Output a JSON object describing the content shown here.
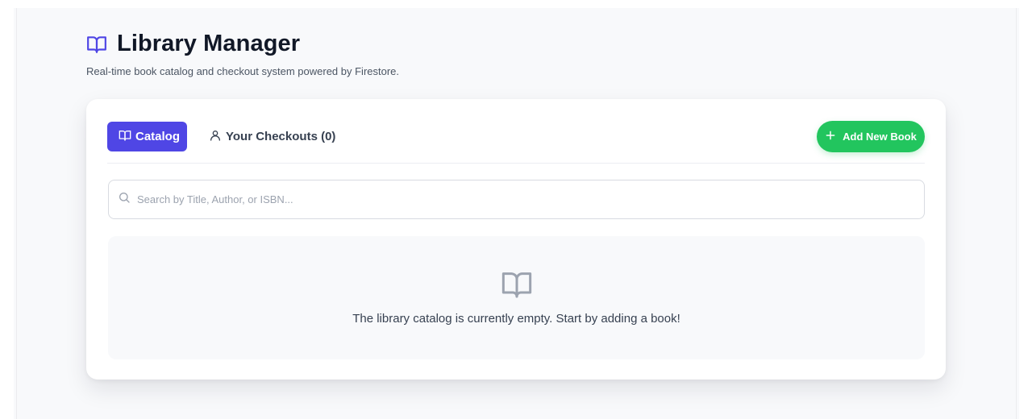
{
  "header": {
    "title": "Library Manager",
    "subtitle": "Real-time book catalog and checkout system powered by Firestore.",
    "icon": "book-open-icon"
  },
  "tabs": {
    "catalog_label": "Catalog",
    "checkouts_label": "Your Checkouts (0)",
    "active": "Catalog"
  },
  "actions": {
    "add_book_label": "Add New Book"
  },
  "search": {
    "value": "",
    "placeholder": "Search by Title, Author, or ISBN..."
  },
  "catalog": {
    "empty_message": "The library catalog is currently empty. Start by adding a book!"
  },
  "colors": {
    "accent": "#4f46e5",
    "success": "#22c55e",
    "background": "#f8f9fb"
  }
}
